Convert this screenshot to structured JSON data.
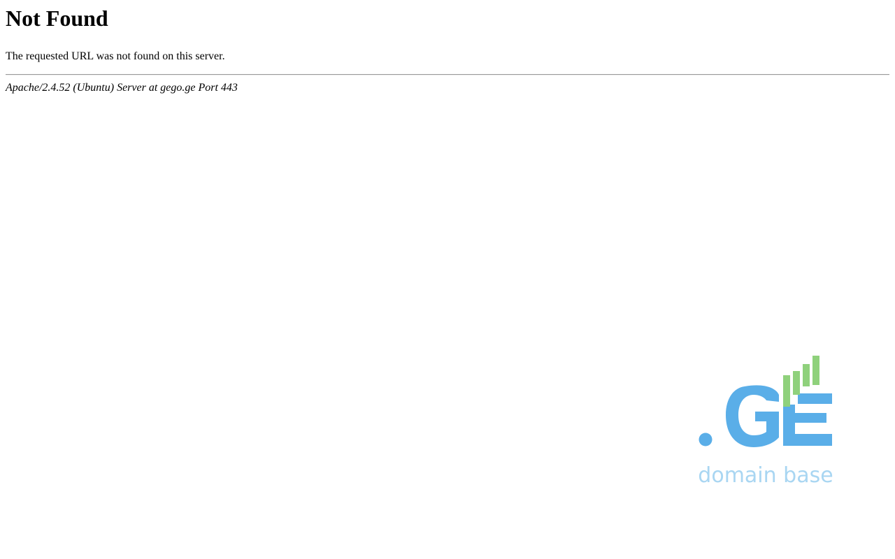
{
  "error": {
    "title": "Not Found",
    "message": "The requested URL was not found on this server.",
    "server_signature": "Apache/2.4.52 (Ubuntu) Server at gego.ge Port 443"
  },
  "logo": {
    "name": ".GE",
    "tagline": "domain base",
    "icon": "signal-bars-icon",
    "colors": {
      "blue": "#5aaee8",
      "green": "#8fd17c",
      "tagline": "#a9d6f2"
    }
  }
}
